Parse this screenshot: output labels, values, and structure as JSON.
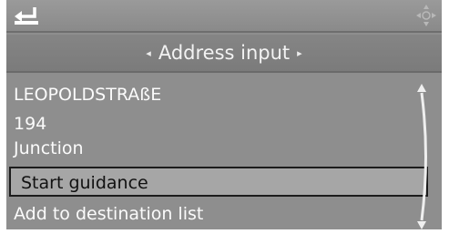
{
  "header": {
    "back_icon": "back-arrow-icon",
    "controller_icon": "controller-direction-icon"
  },
  "title": {
    "label": "Address input",
    "left_arrow": "◂",
    "right_arrow": "▸"
  },
  "address": {
    "street": "LEOPOLDSTRAßE",
    "house_number": "194",
    "junction": "Junction"
  },
  "menu": {
    "start_guidance": "Start guidance",
    "add_to_destination_list": "Add to destination list"
  },
  "colors": {
    "background": "#8e8e8e",
    "text": "#fbfbfb",
    "selected_background": "#a6a6a6",
    "selected_text": "#111111"
  }
}
